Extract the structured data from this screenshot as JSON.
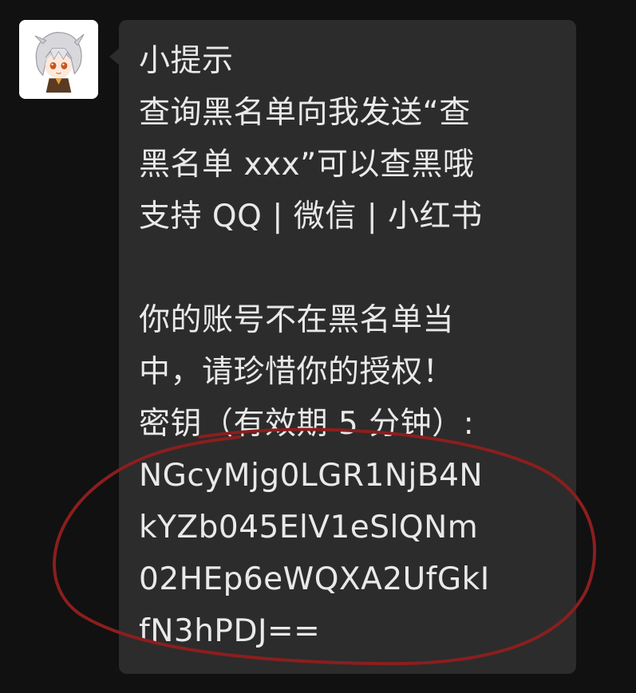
{
  "chat": {
    "avatar_icon": "anime-girl-avatar-icon",
    "message": {
      "lines_part1": [
        "小提示",
        "查询黑名单向我发送“查",
        "黑名单 xxx”可以查黑哦",
        "支持 QQ | 微信 | 小红书"
      ],
      "lines_part2": [
        "你的账号不在黑名单当",
        "中，请珍惜你的授权！",
        "密钥（有效期 5 分钟）:",
        "NGcyMjg0LGR1NjB4N",
        "kYZb045ElV1eSlQNm",
        "02HEp6eWQXA2UfGkI",
        "fN3hPDJ=="
      ]
    },
    "colors": {
      "background": "#111111",
      "bubble": "#2c2c2c",
      "text": "#e9e9e9",
      "annotation": "#8b1e1e"
    }
  }
}
